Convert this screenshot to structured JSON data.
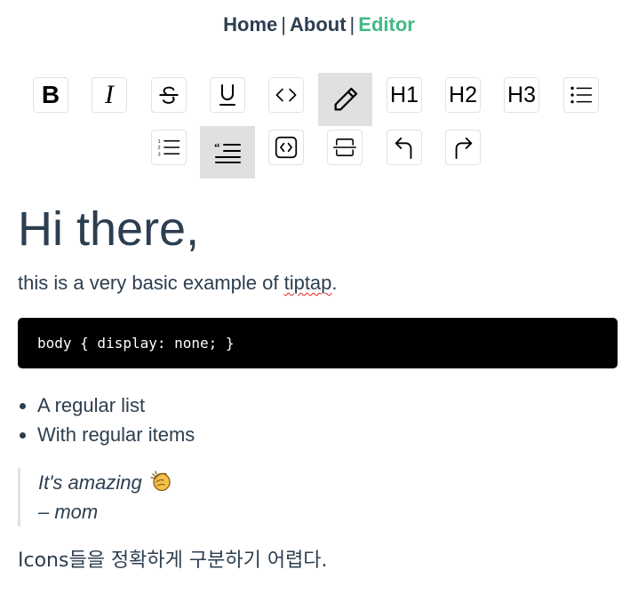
{
  "nav": {
    "home": "Home",
    "about": "About",
    "editor": "Editor",
    "separator": "|",
    "active": "Editor"
  },
  "toolbar": {
    "buttons": [
      {
        "id": "bold",
        "label": "B",
        "icon": "bold-icon"
      },
      {
        "id": "italic",
        "label": "I",
        "icon": "italic-icon"
      },
      {
        "id": "strike",
        "icon": "strikethrough-icon"
      },
      {
        "id": "underline",
        "icon": "underline-icon"
      },
      {
        "id": "code",
        "icon": "code-icon"
      },
      {
        "id": "paragraph",
        "icon": "pencil-icon",
        "active": true
      },
      {
        "id": "h1",
        "label": "H1",
        "icon": "heading-1-icon"
      },
      {
        "id": "h2",
        "label": "H2",
        "icon": "heading-2-icon"
      },
      {
        "id": "h3",
        "label": "H3",
        "icon": "heading-3-icon"
      },
      {
        "id": "bullet-list",
        "icon": "bullet-list-icon"
      },
      {
        "id": "ordered-list",
        "icon": "ordered-list-icon"
      },
      {
        "id": "blockquote",
        "icon": "quote-icon",
        "active": true
      },
      {
        "id": "code-block",
        "icon": "code-block-icon"
      },
      {
        "id": "horizontal-rule",
        "icon": "horizontal-rule-icon"
      },
      {
        "id": "undo",
        "icon": "undo-icon"
      },
      {
        "id": "redo",
        "icon": "redo-icon"
      }
    ]
  },
  "content": {
    "heading": "Hi there,",
    "paragraph_before": "this is a very basic example of ",
    "paragraph_misspelled": "tiptap",
    "paragraph_after": ".",
    "code": "body { display: none; }",
    "list_items": [
      "A regular list",
      "With regular items"
    ],
    "quote_line1": "It's amazing",
    "quote_line2": "– mom",
    "quote_emoji": "clapping-hands-icon",
    "footer_text": "Icons들을 정확하게 구분하기 어렵다."
  },
  "colors": {
    "text": "#2c3e50",
    "accent": "#42b983",
    "active_button_bg": "#e0e0e0",
    "code_bg": "#000000",
    "spellcheck": "#e02020"
  }
}
